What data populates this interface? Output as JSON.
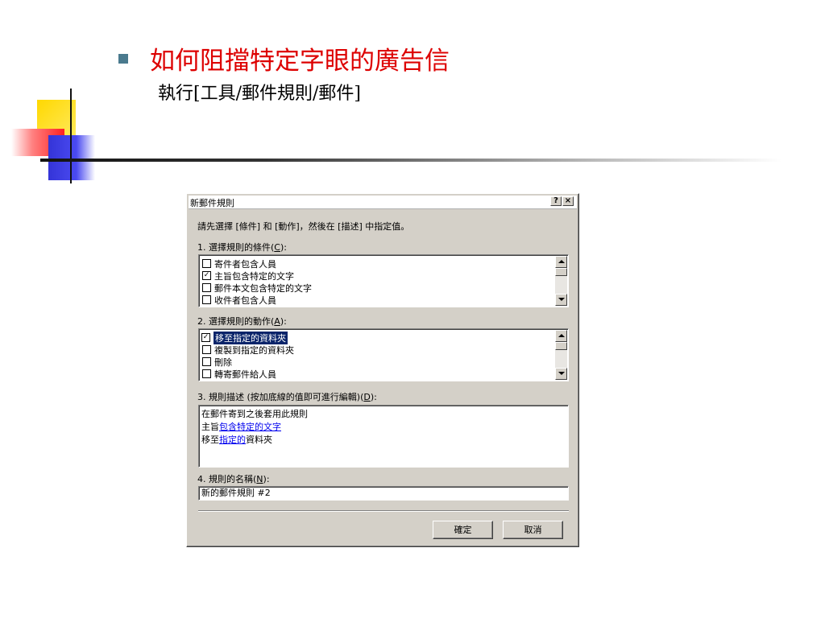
{
  "slide": {
    "title": "如何阻擋特定字眼的廣告信",
    "subtitle": "執行[工具/郵件規則/郵件]"
  },
  "dialog": {
    "title": "新郵件規則",
    "help_label": "?",
    "close_label": "×",
    "instruction": "請先選擇 [條件] 和 [動作]，然後在 [描述] 中指定值。",
    "conditions_label": "1. 選擇規則的條件(",
    "conditions_key": "C",
    "conditions": [
      {
        "label": "寄件者包含人員",
        "checked": false
      },
      {
        "label": "主旨包含特定的文字",
        "checked": true
      },
      {
        "label": "郵件本文包含特定的文字",
        "checked": false
      },
      {
        "label": "收件者包含人員",
        "checked": false
      }
    ],
    "actions_label": "2. 選擇規則的動作(",
    "actions_key": "A",
    "actions": [
      {
        "label": "移至指定的資料夾",
        "checked": true,
        "selected": true
      },
      {
        "label": "複製到指定的資料夾",
        "checked": false
      },
      {
        "label": "刪除",
        "checked": false
      },
      {
        "label": "轉寄郵件給人員",
        "checked": false
      }
    ],
    "description_label": "3. 規則描述 (按加底線的值即可進行編輯)(",
    "description_key": "D",
    "description": {
      "line1": "在郵件寄到之後套用此規則",
      "line2_prefix": "主旨",
      "line2_link": "包含特定的文字",
      "line3_prefix": "移至",
      "line3_link": "指定的",
      "line3_suffix": "資料夾"
    },
    "name_label": "4. 規則的名稱(",
    "name_key": "N",
    "name_value": "新的郵件規則 #2",
    "ok_label": "確定",
    "cancel_label": "取消"
  },
  "colors": {
    "title_red": "#dd0000",
    "selection": "#0a246a",
    "dialog_face": "#d4d0c8",
    "link": "#0000ee"
  }
}
